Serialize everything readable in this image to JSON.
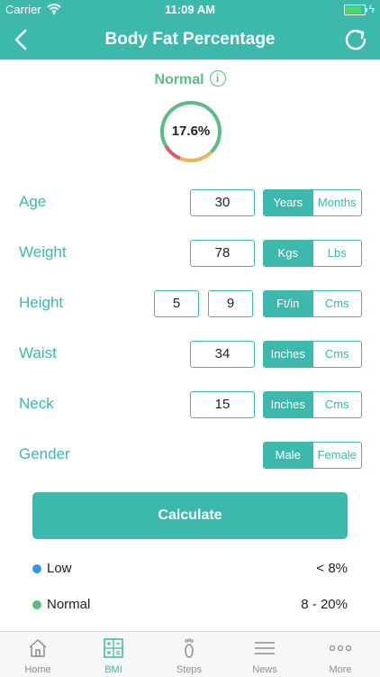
{
  "status_bar": {
    "carrier": "Carrier",
    "time": "11:09 AM"
  },
  "nav": {
    "title": "Body Fat Percentage"
  },
  "result": {
    "status": "Normal",
    "value": "17.6%",
    "status_color": "#5bbd85"
  },
  "form": {
    "age": {
      "label": "Age",
      "value": "30",
      "units": [
        "Years",
        "Months"
      ],
      "selected": "Years"
    },
    "weight": {
      "label": "Weight",
      "value": "78",
      "units": [
        "Kgs",
        "Lbs"
      ],
      "selected": "Kgs"
    },
    "height": {
      "label": "Height",
      "feet": "5",
      "inches": "9",
      "units": [
        "Ft/in",
        "Cms"
      ],
      "selected": "Ft/in"
    },
    "waist": {
      "label": "Waist",
      "value": "34",
      "units": [
        "Inches",
        "Cms"
      ],
      "selected": "Inches"
    },
    "neck": {
      "label": "Neck",
      "value": "15",
      "units": [
        "Inches",
        "Cms"
      ],
      "selected": "Inches"
    },
    "gender": {
      "label": "Gender",
      "options": [
        "Male",
        "Female"
      ],
      "selected": "Male"
    }
  },
  "calculate_label": "Calculate",
  "legend": [
    {
      "name": "Low",
      "range": "< 8%",
      "color": "#3498db"
    },
    {
      "name": "Normal",
      "range": "8 - 20%",
      "color": "#5bbd85"
    }
  ],
  "tabs": [
    {
      "label": "Home",
      "icon": "home-icon"
    },
    {
      "label": "BMI",
      "icon": "calculator-icon",
      "active": true
    },
    {
      "label": "Steps",
      "icon": "footprint-icon"
    },
    {
      "label": "News",
      "icon": "news-icon"
    },
    {
      "label": "More",
      "icon": "more-icon"
    }
  ],
  "colors": {
    "accent": "#3cb9ac"
  }
}
